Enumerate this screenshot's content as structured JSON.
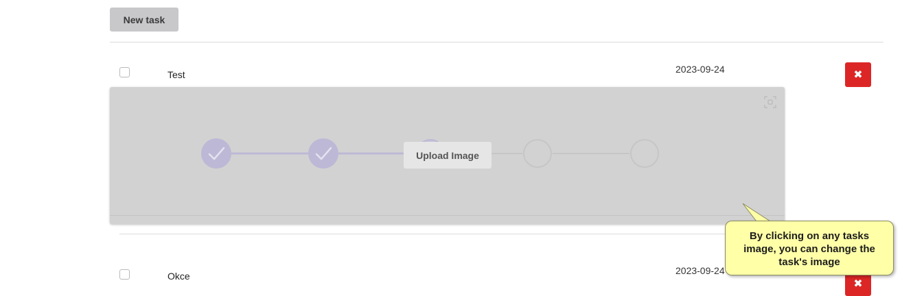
{
  "toolbar": {
    "new_task_label": "New task"
  },
  "tasks": [
    {
      "title": "Test",
      "date": "2023-09-24",
      "delete_icon": "✖"
    },
    {
      "title": "Okce",
      "date": "2023-09-24",
      "delete_icon": "✖"
    }
  ],
  "image_panel": {
    "upload_label": "Upload Image",
    "steps_total": 5,
    "steps_completed": 2,
    "corner_icon": "screenshot-icon"
  },
  "tooltip": {
    "lines": [
      "By clicking on any tasks",
      "image, you can change the",
      "task's image"
    ]
  },
  "colors": {
    "delete_button": "#dc2626",
    "tooltip_background": "#ffffa8",
    "step_done": "#bdb8d6"
  }
}
